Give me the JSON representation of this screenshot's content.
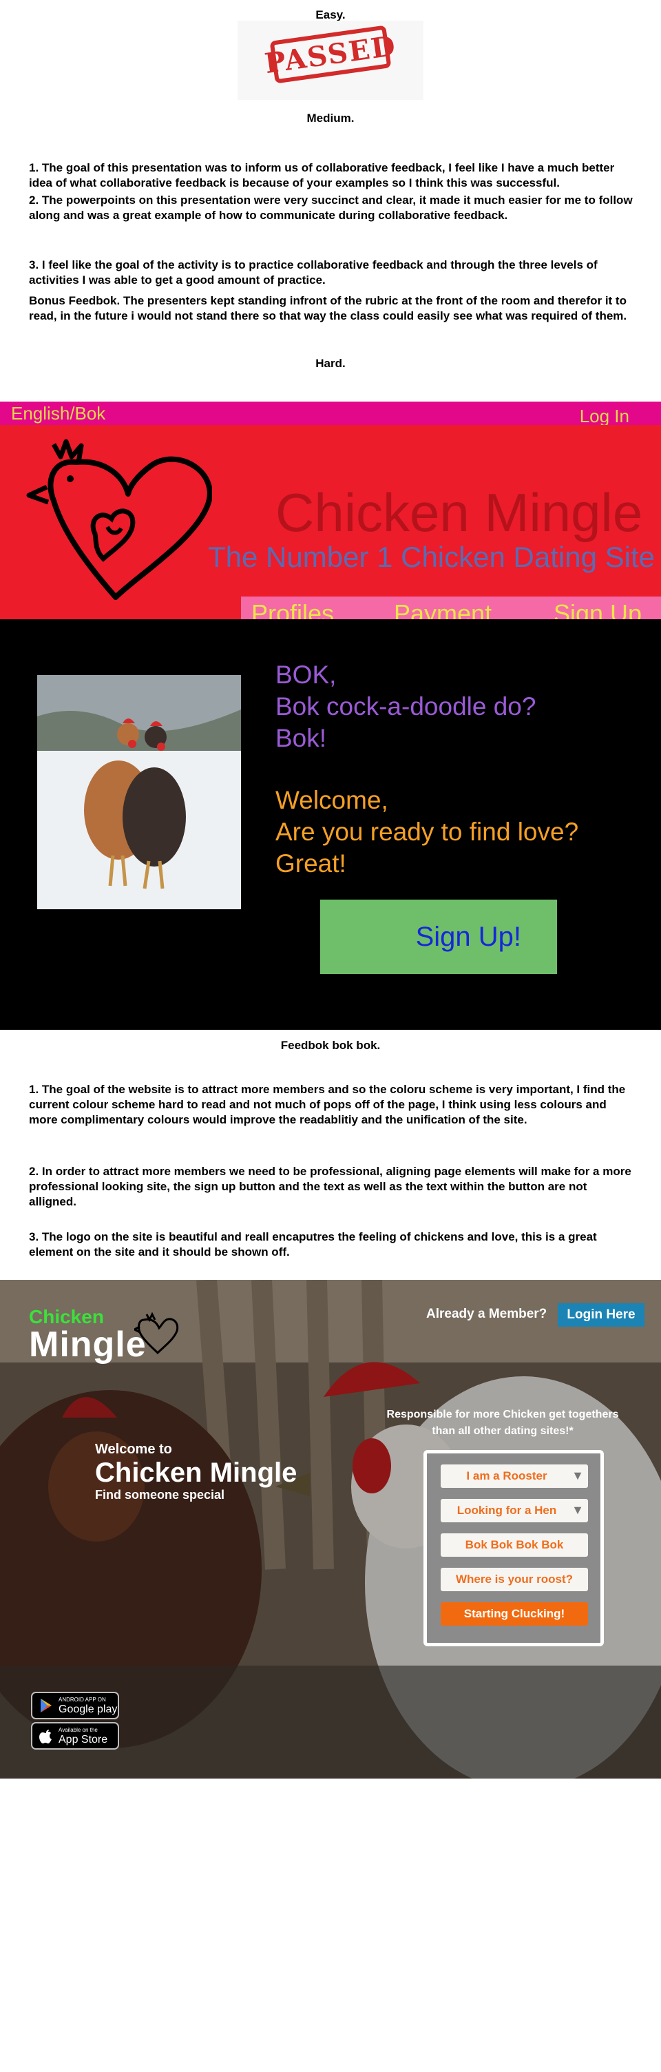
{
  "section1": {
    "easy_heading": "Easy.",
    "stamp_text": "PASSED",
    "medium_heading": "Medium.",
    "paragraphs": [
      "1. The goal of this presentation was to inform us of collaborative feedback, I feel like I have a much better idea of what collaborative feedback is because of your examples so I think this was successful.",
      "2. The powerpoints on this presentation were very succinct and clear, it made it much easier for me to follow along and was a great example of how to communicate during collaborative feedback.",
      "3. I feel like the goal of the activity is to practice collaborative feedback and through the three levels of activities I was able to get a good amount of practice.",
      "Bonus Feedbok. The presenters kept standing infront of the rubric at the front of the room and therefor it to read, in the future i would not stand there so that way the class could easily see what was required of them."
    ],
    "hard_heading": "Hard."
  },
  "mockup1": {
    "lang": "English/Bok",
    "login": "Log In",
    "title": "Chicken Mingle",
    "tagline": "The Number 1 Chicken Dating Site",
    "nav": [
      "Profiles",
      "Payment",
      "Sign Up"
    ],
    "bok_lines": [
      "BOK,",
      "Bok cock-a-doodle do?",
      "Bok!"
    ],
    "welcome_lines": [
      "Welcome,",
      "Are you ready to find love?",
      "Great!"
    ],
    "signup": "Sign Up!",
    "colors": {
      "topbar": "#e3088a",
      "hero": "#ec1c2a",
      "nav": "#f56aa6",
      "button": "#6fbf6a"
    }
  },
  "section2": {
    "heading": "Feedbok bok bok.",
    "paragraphs": [
      "1. The goal of the website is to attract more members and so the coloru scheme is very important, I find the current colour scheme hard to read and not much of pops off of the page, I think using less colours and more complimentary colours would improve the readablitiy and the unification of the site.",
      "2. In order to attract more members we need to be professional, aligning page elements will make for a more professional looking site, the sign up button and the text as well as the text within the button are not alligned.",
      "3. The logo on the site is beautiful and reall encaputres the feeling of chickens and love, this is a great element on the site and it should be shown off."
    ]
  },
  "mockup2": {
    "logo_top": "Chicken",
    "logo_bottom": "Mingle",
    "already_member": "Already a Member?",
    "login_button": "Login Here",
    "responsible": "Responsible for more Chicken get togethers than all other dating sites!*",
    "welcome_to": "Welcome to",
    "site_name": "Chicken Mingle",
    "find": "Find someone special",
    "form": {
      "i_am": "I am a Rooster",
      "looking_for": "Looking for a Hen",
      "field3": "Bok Bok Bok Bok",
      "field4": "Where is your roost?",
      "start": "Starting Clucking!"
    },
    "google_small": "ANDROID APP ON",
    "google_big": "Google play",
    "apple_small": "Available on the",
    "apple_big": "App Store"
  }
}
